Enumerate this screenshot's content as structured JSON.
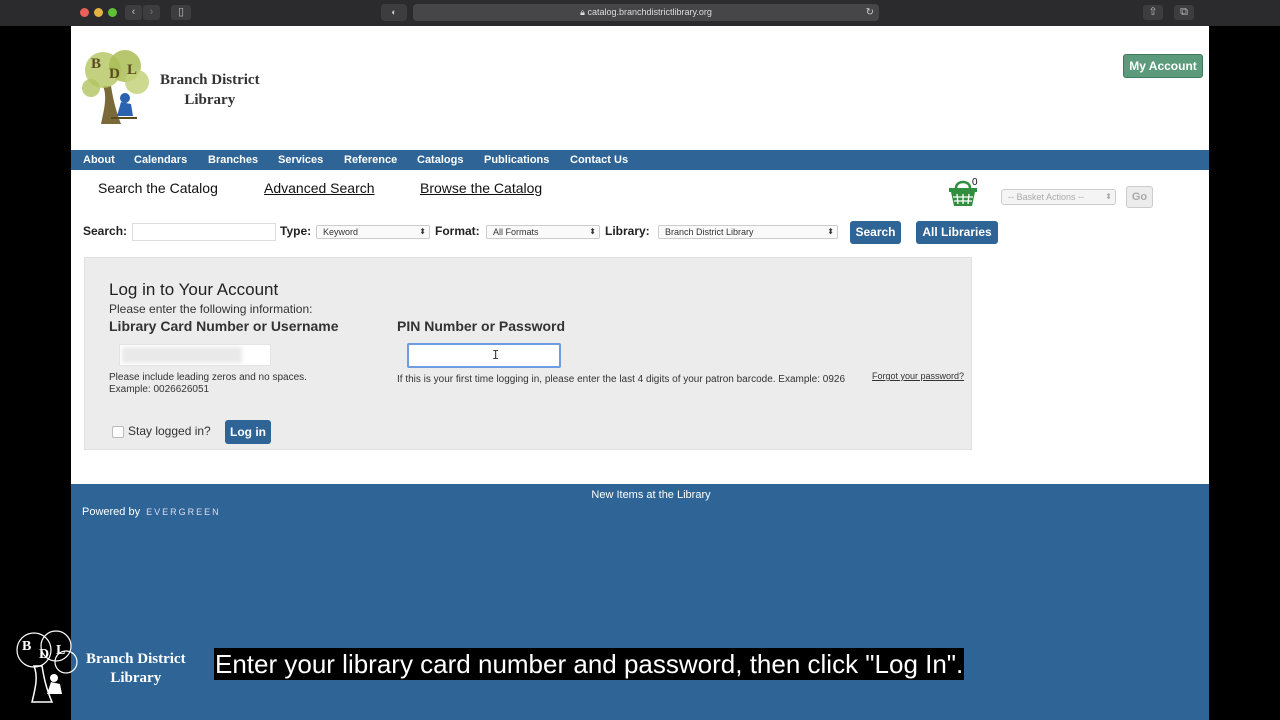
{
  "browser": {
    "url": "catalog.branchdistrictlibrary.org"
  },
  "header": {
    "logo_text": "Branch District\nLibrary",
    "logo_letters": "BDL",
    "my_account": "My Account"
  },
  "nav": [
    "About",
    "Calendars",
    "Branches",
    "Services",
    "Reference",
    "Catalogs",
    "Publications",
    "Contact Us"
  ],
  "tabs": {
    "search": "Search the Catalog",
    "advanced": "Advanced Search",
    "browse": "Browse the Catalog"
  },
  "basket": {
    "count": "0",
    "actions": "-- Basket Actions --",
    "go": "Go"
  },
  "search_bar": {
    "search_label": "Search:",
    "type_label": "Type:",
    "type_value": "Keyword",
    "format_label": "Format:",
    "format_value": "All Formats",
    "library_label": "Library:",
    "library_value": "Branch District Library",
    "search_button": "Search",
    "all_libraries_button": "All Libraries"
  },
  "login": {
    "title": "Log in to Your Account",
    "subtitle": "Please enter the following information:",
    "card_label": "Library Card Number or Username",
    "pin_label": "PIN Number or Password",
    "card_hint_1": "Please include leading zeros and no spaces.",
    "card_hint_2": "Example: 0026626051",
    "pin_hint": "If this is your first time logging in, please enter the last 4 digits of your patron barcode. Example: 0926",
    "forgot": "Forgot your password?",
    "stay_logged_in": "Stay logged in?",
    "login_button": "Log in"
  },
  "footer": {
    "new_items": "New Items at the Library",
    "powered_by": "Powered by",
    "evergreen": "EVERGREEN"
  },
  "overlay": {
    "watermark_text": "Branch District\nLibrary",
    "caption": "Enter your library card number and password, then click \"Log In\"."
  },
  "colors": {
    "brand_blue": "#2e6496",
    "account_green": "#5b9a7a",
    "basket_green": "#2f8f3e"
  }
}
